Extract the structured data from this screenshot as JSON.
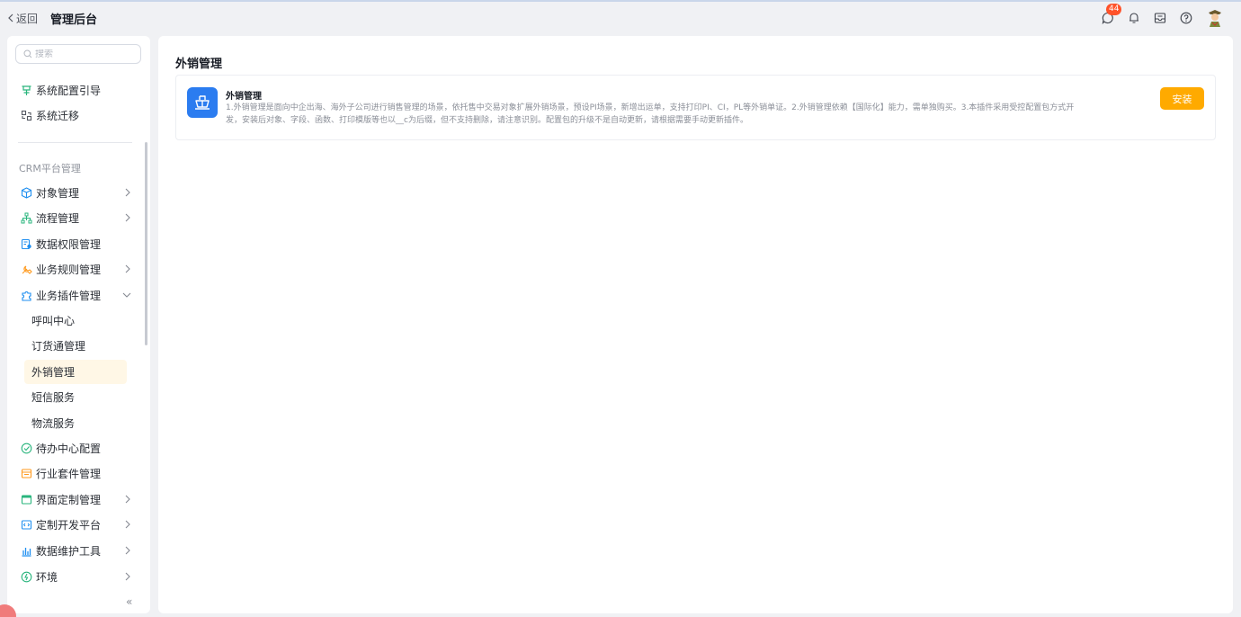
{
  "header": {
    "back_label": "返回",
    "title": "管理后台",
    "notification_count": "44",
    "icons": [
      "chat-bubble-icon",
      "bell-icon",
      "inbox-icon",
      "help-icon",
      "avatar"
    ]
  },
  "sidebar": {
    "search_placeholder": "搜索",
    "top_items": [
      {
        "label": "系统配置引导",
        "icon": "config-guide-icon",
        "icon_color": "#2ab57d"
      },
      {
        "label": "系统迁移",
        "icon": "migrate-icon",
        "icon_color": "#545861"
      }
    ],
    "section_label": "CRM平台管理",
    "items": [
      {
        "label": "对象管理",
        "icon": "cube-icon",
        "icon_color": "#1f8ff0",
        "expandable": true
      },
      {
        "label": "流程管理",
        "icon": "flow-icon",
        "icon_color": "#2ab57d",
        "expandable": true
      },
      {
        "label": "数据权限管理",
        "icon": "data-permission-icon",
        "icon_color": "#1f8ff0",
        "expandable": false
      },
      {
        "label": "业务规则管理",
        "icon": "rule-icon",
        "icon_color": "#ff9a1e",
        "expandable": true
      },
      {
        "label": "业务插件管理",
        "icon": "plugin-icon",
        "icon_color": "#1f8ff0",
        "expandable": true,
        "expanded": true
      }
    ],
    "sub_items": [
      {
        "label": "呼叫中心",
        "active": false
      },
      {
        "label": "订货通管理",
        "active": false
      },
      {
        "label": "外销管理",
        "active": true
      },
      {
        "label": "短信服务",
        "active": false
      },
      {
        "label": "物流服务",
        "active": false
      }
    ],
    "items_after": [
      {
        "label": "待办中心配置",
        "icon": "todo-icon",
        "icon_color": "#2ab57d",
        "expandable": false
      },
      {
        "label": "行业套件管理",
        "icon": "suite-icon",
        "icon_color": "#ff9a1e",
        "expandable": false
      },
      {
        "label": "界面定制管理",
        "icon": "layout-icon",
        "icon_color": "#2ab57d",
        "expandable": true
      },
      {
        "label": "定制开发平台",
        "icon": "code-icon",
        "icon_color": "#1f8ff0",
        "expandable": true
      },
      {
        "label": "数据维护工具",
        "icon": "bar-chart-icon",
        "icon_color": "#1f8ff0",
        "expandable": true
      },
      {
        "label": "环境",
        "icon": "environment-icon",
        "icon_color": "#2ab57d",
        "expandable": true
      }
    ],
    "collapse_label": "«"
  },
  "main": {
    "title": "外销管理",
    "card": {
      "icon": "ship-icon",
      "icon_color": "#2b7cf0",
      "title": "外销管理",
      "description_line1": "1.外销管理是面向中企出海、海外子公司进行销售管理的场景，依托售中交易对象扩展外销场景，预设PI场景，新增出运单，支持打印PI、CI，PL等外销单证。2.外销管理依赖【国际化】能力，需单独购买。3.本插件采用受控配置包方式开",
      "description_line2": "发，安装后对象、字段、函数、打印模版等也以__c为后缀，但不支持删除，请注意识别。配置包的升级不是自动更新，请根据需要手动更新插件。",
      "install_label": "安装",
      "install_color": "#ffaa00"
    }
  }
}
